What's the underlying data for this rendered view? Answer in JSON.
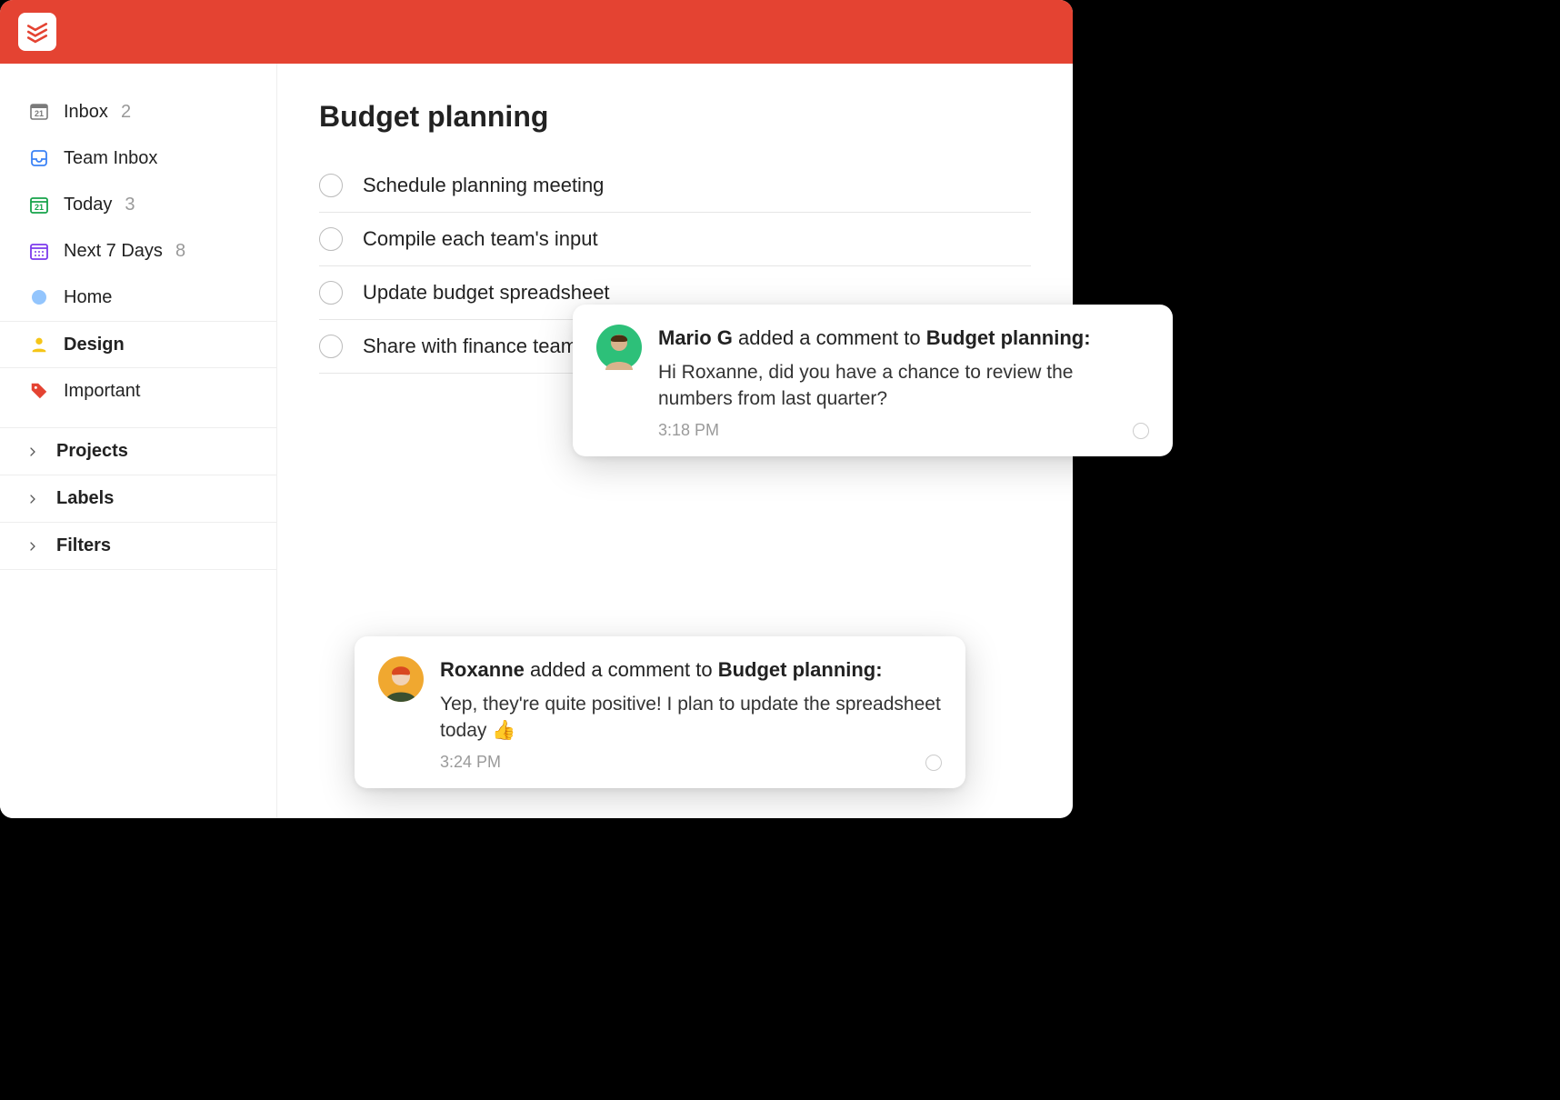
{
  "sidebar": {
    "inbox": {
      "label": "Inbox",
      "count": "2"
    },
    "team_inbox": {
      "label": "Team Inbox"
    },
    "today": {
      "label": "Today",
      "count": "3",
      "day": "21"
    },
    "next7": {
      "label": "Next 7 Days",
      "count": "8"
    },
    "home": {
      "label": "Home"
    },
    "design": {
      "label": "Design"
    },
    "important": {
      "label": "Important"
    },
    "sections": {
      "projects": "Projects",
      "labels": "Labels",
      "filters": "Filters"
    }
  },
  "project": {
    "title": "Budget planning",
    "tasks": [
      "Schedule planning meeting",
      "Compile each team's input",
      "Update budget spreadsheet",
      "Share with finance team"
    ]
  },
  "notifications": [
    {
      "author": "Mario G",
      "action": " added a comment to ",
      "target": "Budget planning:",
      "message": "Hi Roxanne, did you have a chance to review the numbers from last quarter?",
      "time": "3:18 PM",
      "avatar_bg": "#2dc079"
    },
    {
      "author": "Roxanne",
      "action": " added a comment to ",
      "target": "Budget planning:",
      "message": "Yep, they're quite positive! I plan to update the spreadsheet today 👍",
      "time": "3:24 PM",
      "avatar_bg": "#f0a830"
    }
  ],
  "icons": {
    "inbox_day": "21"
  }
}
